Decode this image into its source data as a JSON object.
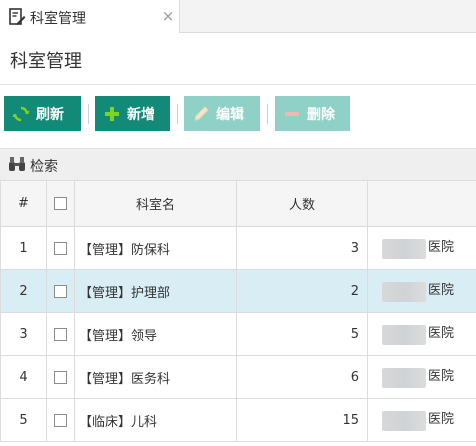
{
  "tab": {
    "label": "科室管理",
    "close": "×"
  },
  "page": {
    "title": "科室管理"
  },
  "toolbar": {
    "refresh": "刷新",
    "add": "新增",
    "edit": "编辑",
    "delete": "删除"
  },
  "search": {
    "label": "检索"
  },
  "table": {
    "headers": {
      "index": "#",
      "name": "科室名",
      "count": "人数",
      "org": ""
    },
    "rows": [
      {
        "index": "1",
        "name": "【管理】防保科",
        "count": "3",
        "org": "医院",
        "selected": false
      },
      {
        "index": "2",
        "name": "【管理】护理部",
        "count": "2",
        "org": "医院",
        "selected": true
      },
      {
        "index": "3",
        "name": "【管理】领导",
        "count": "5",
        "org": "医院",
        "selected": false
      },
      {
        "index": "4",
        "name": "【管理】医务科",
        "count": "6",
        "org": "医院",
        "selected": false
      },
      {
        "index": "5",
        "name": "【临床】儿科",
        "count": "15",
        "org": "医院",
        "selected": false
      }
    ]
  },
  "colors": {
    "primary": "#138a78",
    "disabled": "#8fd1c6",
    "selected_row": "#d9edf4"
  },
  "icons": {
    "tab": "edit-document-icon",
    "refresh": "refresh-icon",
    "add": "plus-icon",
    "edit": "pencil-icon",
    "delete": "minus-icon",
    "search": "binoculars-icon"
  }
}
